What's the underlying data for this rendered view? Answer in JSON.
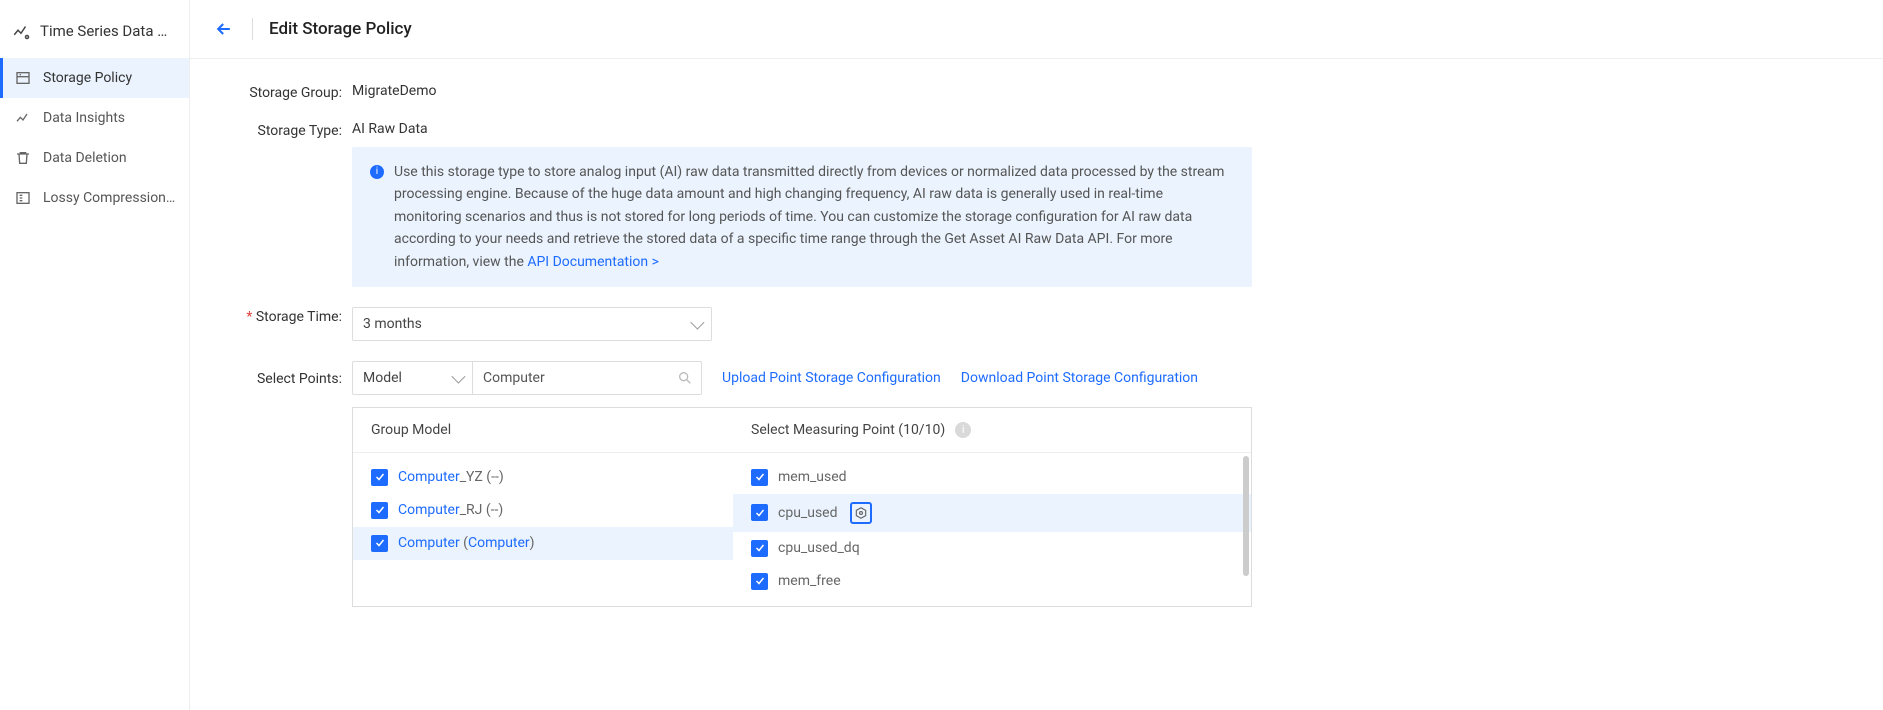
{
  "sidebar": {
    "title": "Time Series Data …",
    "items": [
      {
        "label": "Storage Policy",
        "icon": "storage-icon",
        "active": true
      },
      {
        "label": "Data Insights",
        "icon": "insights-icon",
        "active": false
      },
      {
        "label": "Data Deletion",
        "icon": "deletion-icon",
        "active": false
      },
      {
        "label": "Lossy Compression…",
        "icon": "compression-icon",
        "active": false
      }
    ]
  },
  "header": {
    "title": "Edit Storage Policy"
  },
  "form": {
    "storage_group_label": "Storage Group:",
    "storage_group_value": "MigrateDemo",
    "storage_type_label": "Storage Type:",
    "storage_type_value": "AI Raw Data",
    "info_text": "Use this storage type to store analog input (AI) raw data transmitted directly from devices or normalized data processed by the stream processing engine. Because of the huge data amount and high changing frequency, AI raw data is generally used in real-time monitoring scenarios and thus is not stored for long periods of time. You can customize the storage configuration for AI raw data according to your needs and retrieve the stored data of a specific time range through the Get Asset AI Raw Data API. For more information, view the ",
    "info_link": "API Documentation >",
    "storage_time_label": "Storage Time:",
    "storage_time_value": "3 months",
    "select_points_label": "Select Points:",
    "model_select_value": "Model",
    "search_placeholder": "Computer",
    "upload_link": "Upload Point Storage Configuration",
    "download_link": "Download Point Storage Configuration"
  },
  "table": {
    "left_header": "Group Model",
    "right_header": "Select Measuring Point (10/10)",
    "models": [
      {
        "link": "Computer",
        "rest": "_YZ (--)",
        "selected": false
      },
      {
        "link": "Computer",
        "rest": "_RJ (--)",
        "selected": false
      },
      {
        "link": "Computer",
        "paren_link": "Computer",
        "rest_before": " (",
        "rest_after": ")",
        "selected": true
      }
    ],
    "points": [
      {
        "label": "mem_used",
        "hover": false,
        "gear": false
      },
      {
        "label": "cpu_used",
        "hover": true,
        "gear": true
      },
      {
        "label": "cpu_used_dq",
        "hover": false,
        "gear": false
      },
      {
        "label": "mem_free",
        "hover": false,
        "gear": false
      }
    ]
  }
}
